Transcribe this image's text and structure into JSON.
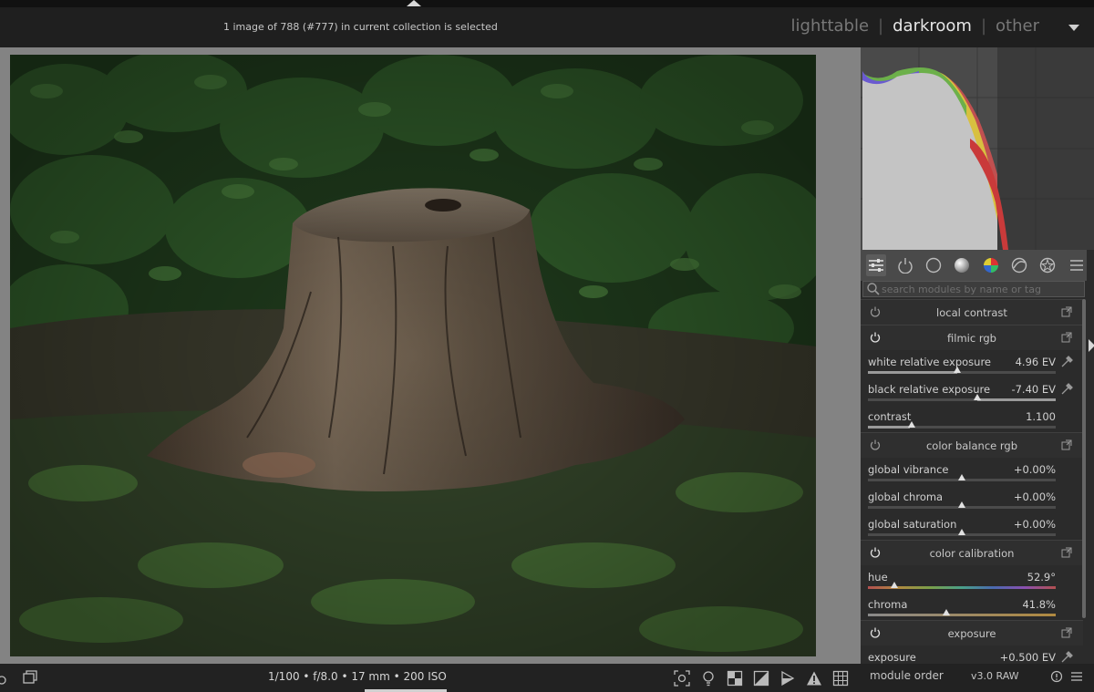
{
  "header": {
    "selection_info": "1 image of 788 (#777) in current collection is selected",
    "views": [
      {
        "label": "lighttable",
        "active": false
      },
      {
        "label": "darkroom",
        "active": true
      },
      {
        "label": "other",
        "active": false
      }
    ]
  },
  "search": {
    "placeholder": "search modules by name or tag"
  },
  "module_groups": [
    "quick-access-icon",
    "power-icon",
    "circle-icon",
    "tone-icon",
    "color-icon",
    "correct-icon",
    "effect-icon",
    "menu-icon"
  ],
  "modules": {
    "local_contrast": {
      "name": "local contrast"
    },
    "filmic": {
      "name": "filmic rgb",
      "white_label": "white relative exposure",
      "white_value": "4.96 EV",
      "black_label": "black relative exposure",
      "black_value": "-7.40 EV",
      "contrast_label": "contrast",
      "contrast_value": "1.100"
    },
    "color_balance": {
      "name": "color balance rgb",
      "vibrance_label": "global vibrance",
      "vibrance_value": "+0.00%",
      "chroma_label": "global chroma",
      "chroma_value": "+0.00%",
      "saturation_label": "global saturation",
      "saturation_value": "+0.00%"
    },
    "color_calibration": {
      "name": "color calibration",
      "hue_label": "hue",
      "hue_value": "52.9°",
      "chroma_label": "chroma",
      "chroma_value": "41.8%"
    },
    "exposure": {
      "name": "exposure",
      "exposure_label": "exposure",
      "exposure_value": "+0.500 EV"
    }
  },
  "bottom": {
    "exif": "1/100 • f/8.0 • 17 mm • 200 ISO",
    "module_order_label": "module order",
    "module_order_value": "v3.0 RAW"
  },
  "colors": {
    "accent_active": "#e6e6e6",
    "panel_bg": "#2b2b2b",
    "center_bg": "#838383"
  }
}
